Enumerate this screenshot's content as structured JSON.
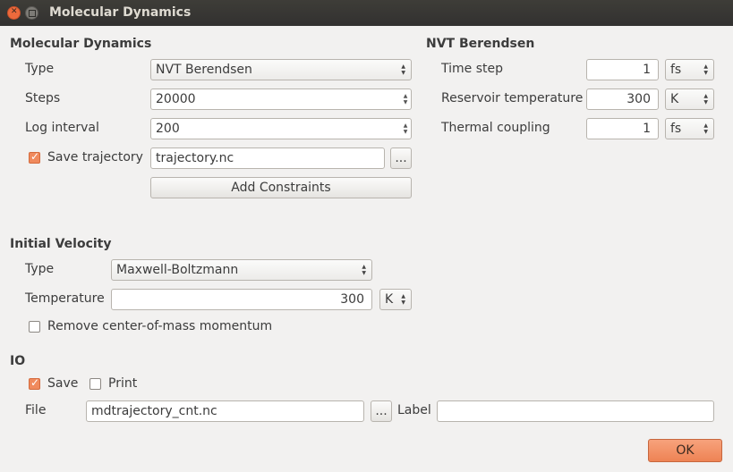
{
  "window": {
    "title": "Molecular Dynamics"
  },
  "md": {
    "heading": "Molecular Dynamics",
    "type_label": "Type",
    "type_value": "NVT Berendsen",
    "steps_label": "Steps",
    "steps_value": "20000",
    "log_label": "Log interval",
    "log_value": "200",
    "save_traj_label": "Save trajectory",
    "save_traj_checked": true,
    "traj_file": "trajectory.nc",
    "browse": "...",
    "add_constraints": "Add Constraints"
  },
  "nvt": {
    "heading": "NVT Berendsen",
    "time_step_label": "Time step",
    "time_step_value": "1",
    "time_step_unit": "fs",
    "res_temp_label": "Reservoir temperature",
    "res_temp_value": "300",
    "res_temp_unit": "K",
    "coupling_label": "Thermal coupling",
    "coupling_value": "1",
    "coupling_unit": "fs"
  },
  "velocity": {
    "heading": "Initial Velocity",
    "type_label": "Type",
    "type_value": "Maxwell-Boltzmann",
    "temp_label": "Temperature",
    "temp_value": "300",
    "temp_unit": "K",
    "remove_com_label": "Remove center-of-mass momentum",
    "remove_com_checked": false
  },
  "io": {
    "heading": "IO",
    "save_label": "Save",
    "save_checked": true,
    "print_label": "Print",
    "print_checked": false,
    "file_label": "File",
    "file_value": "mdtrajectory_cnt.nc",
    "browse": "...",
    "label_label": "Label",
    "label_value": ""
  },
  "footer": {
    "ok": "OK"
  }
}
